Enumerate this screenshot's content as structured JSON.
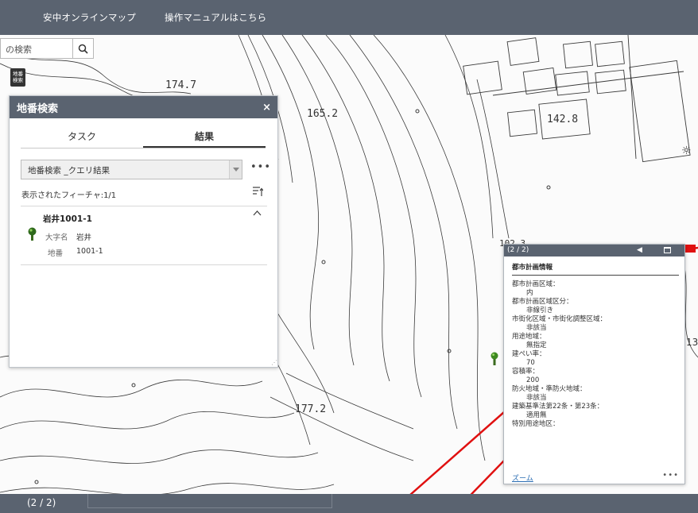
{
  "header": {
    "app_title": "安中オンラインマップ",
    "manual_link": "操作マニュアルはこちら"
  },
  "search": {
    "value": "の検索"
  },
  "lot_search_button": {
    "line1": "地番",
    "line2": "検索"
  },
  "map_labels": {
    "elev1": "174.7",
    "elev2": "165.2",
    "elev3": "142.8",
    "elev4": "177.2",
    "elev5": "13",
    "elev6": "102.3"
  },
  "panel": {
    "title": "地番検索",
    "close": "×",
    "tabs": [
      "タスク",
      "結果"
    ],
    "select_value": "地番検索 _クエリ結果",
    "more": "•••",
    "feature_count": "表示されたフィーチャ:1/1",
    "result": {
      "title": "岩井1001-1",
      "attr1_label": "大字名",
      "attr1_value": "岩井",
      "attr2_label": "地番",
      "attr2_value": "1001-1"
    }
  },
  "popup": {
    "counter": "(2 / 2)",
    "section": "都市計画情報",
    "rows": [
      {
        "label": "都市計画区域：",
        "value": "内"
      },
      {
        "label": "都市計画区域区分：",
        "value": "非線引き"
      },
      {
        "label": "市街化区域・市街化調整区域：",
        "value": "非該当"
      },
      {
        "label": "用途地域：",
        "value": "無指定"
      },
      {
        "label": "建ぺい率：",
        "value": "70"
      },
      {
        "label": "容積率：",
        "value": "200"
      },
      {
        "label": "防火地域・準防火地域：",
        "value": "非該当"
      },
      {
        "label": "建築基準法第22条・第23条：",
        "value": "適用無"
      },
      {
        "label": "特別用途地区：",
        "value": ""
      }
    ],
    "zoom": "ズーム",
    "more": "•••"
  },
  "bottom_bar": {
    "counter": "(2 / 2)"
  },
  "colors": {
    "header_bg": "#5a6370",
    "annotation_red": "#e01010",
    "link_blue": "#2a6db3"
  }
}
